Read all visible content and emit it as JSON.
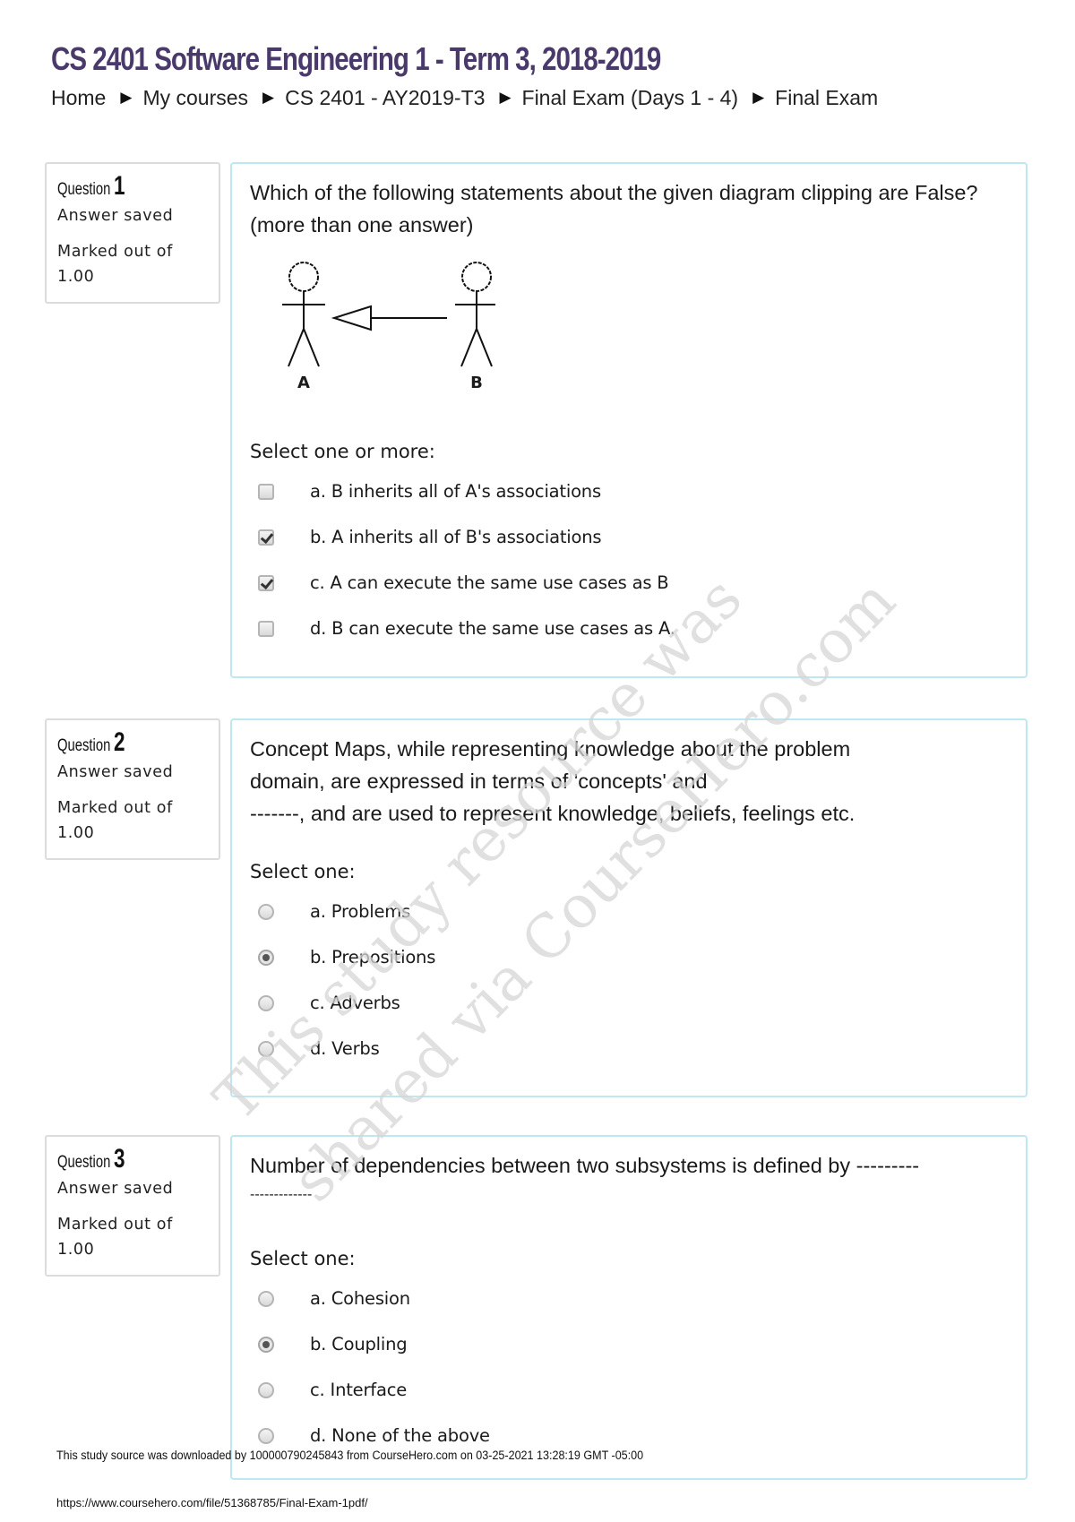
{
  "header": {
    "title": "CS 2401 Software Engineering 1 - Term 3, 2018-2019",
    "breadcrumb": [
      {
        "label": "Home"
      },
      {
        "label": "My courses"
      },
      {
        "label": "CS 2401 - AY2019-T3"
      },
      {
        "label": "Final Exam (Days 1 - 4)"
      },
      {
        "label": "Final Exam"
      }
    ],
    "separator_icon": "▶"
  },
  "questions": [
    {
      "word": "Question",
      "number": "1",
      "state": "Answer saved",
      "grade": "Marked out of 1.00",
      "text": "Which of the following statements about the given diagram clipping are False? (more than one answer)",
      "diagram": {
        "actor_left": "A",
        "actor_right": "B",
        "relation": "generalization arrow from B to A"
      },
      "prompt": "Select one or more:",
      "type": "checkbox",
      "answers": [
        {
          "label": "a. B inherits all of A's associations",
          "selected": false
        },
        {
          "label": "b. A inherits all of B's associations",
          "selected": true
        },
        {
          "label": "c. A can execute the same use cases as B",
          "selected": true
        },
        {
          "label": "d. B can execute the same use cases as A.",
          "selected": false
        }
      ]
    },
    {
      "word": "Question",
      "number": "2",
      "state": "Answer saved",
      "grade": "Marked out of 1.00",
      "text_lines": [
        "Concept Maps, while representing knowledge about the problem",
        "domain, are expressed in terms of 'concepts' and",
        "-------, and are used to represent knowledge, beliefs, feelings etc."
      ],
      "prompt": "Select one:",
      "type": "radio",
      "answers": [
        {
          "label": "a. Problems",
          "selected": false
        },
        {
          "label": "b. Prepositions",
          "selected": true
        },
        {
          "label": "c. Adverbs",
          "selected": false
        },
        {
          "label": "d. Verbs",
          "selected": false
        }
      ]
    },
    {
      "word": "Question",
      "number": "3",
      "state": "Answer saved",
      "grade": "Marked out of 1.00",
      "text_lines": [
        "Number of dependencies between two subsystems is defined by ---------",
        "-------------"
      ],
      "prompt": "Select one:",
      "type": "radio",
      "answers": [
        {
          "label": "a. Cohesion",
          "selected": false
        },
        {
          "label": "b. Coupling",
          "selected": true
        },
        {
          "label": "c. Interface",
          "selected": false
        },
        {
          "label": "d. None of the above",
          "selected": false
        }
      ]
    }
  ],
  "watermark": {
    "line1": "This study resource was",
    "line2": "shared via CourseHero.com"
  },
  "footer": {
    "download_note": "This study source was downloaded by 100000790245843 from CourseHero.com on 03-25-2021 13:28:19 GMT -05:00",
    "url": "https://www.coursehero.com/file/51368785/Final-Exam-1pdf/"
  },
  "colors": {
    "title": "#4a3a6b",
    "content_border": "#bfe7f1",
    "info_border": "#dcdcdc",
    "watermark": "#d6d6d6"
  }
}
